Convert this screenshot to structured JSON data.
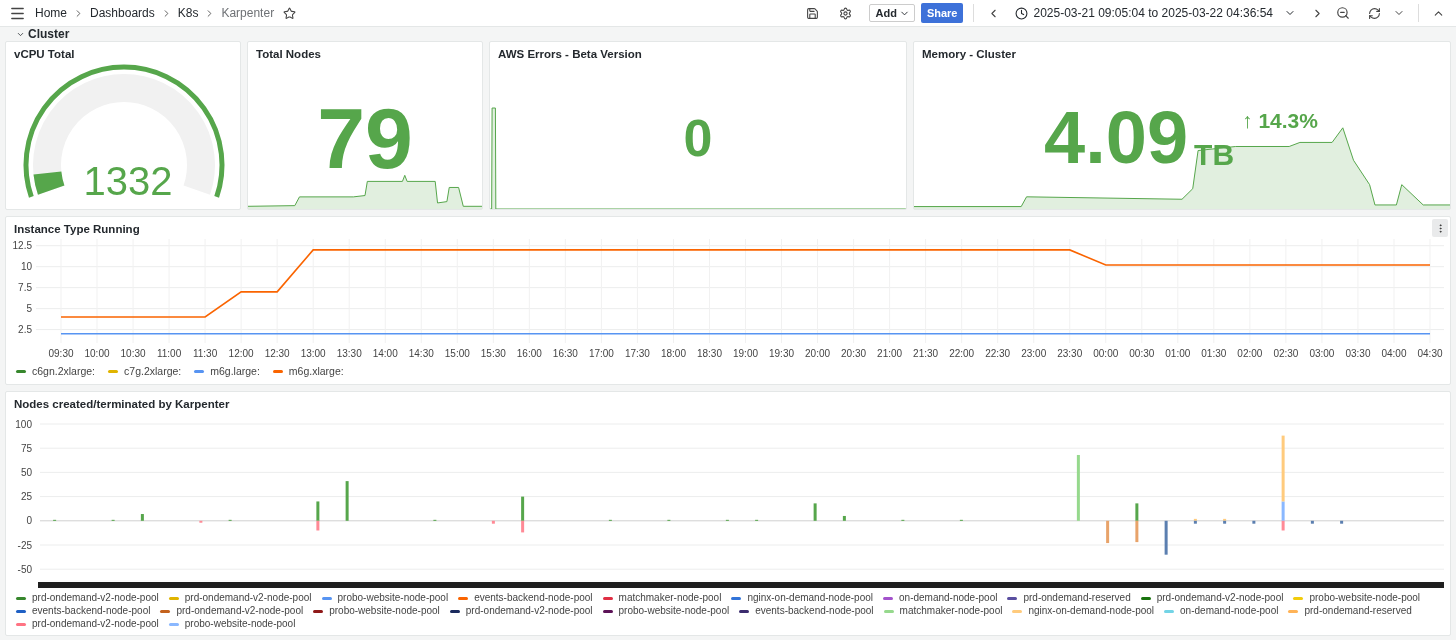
{
  "header": {
    "breadcrumbs": [
      "Home",
      "Dashboards",
      "K8s",
      "Karpenter"
    ],
    "add_button": "Add",
    "share_button": "Share",
    "time_range": "2025-03-21 09:05:04 to 2025-03-22 04:36:54"
  },
  "cluster_row": {
    "title": "Cluster",
    "expanded": true
  },
  "stats": [
    {
      "kind": "gauge",
      "title": "vCPU Total",
      "value": "1332",
      "level": 0.06
    },
    {
      "kind": "stat",
      "title": "Total Nodes",
      "value": "79"
    },
    {
      "kind": "stat",
      "title": "AWS Errors - Beta Version",
      "value": "0"
    },
    {
      "kind": "stat",
      "title": "Memory - Cluster",
      "value": "4.09",
      "unit": "TB",
      "change": "↑ 14.3%"
    }
  ],
  "instance_chart": {
    "title": "Instance Type Running",
    "chart_data": {
      "type": "line",
      "grid": true,
      "x": [
        "09:30",
        "10:00",
        "10:30",
        "11:00",
        "11:30",
        "12:00",
        "12:30",
        "13:00",
        "13:30",
        "14:00",
        "14:30",
        "15:00",
        "15:30",
        "16:00",
        "16:30",
        "17:00",
        "17:30",
        "18:00",
        "18:30",
        "19:00",
        "19:30",
        "20:00",
        "20:30",
        "21:00",
        "21:30",
        "22:00",
        "22:30",
        "23:00",
        "23:30",
        "00:00",
        "00:30",
        "01:00",
        "01:30",
        "02:00",
        "02:30",
        "03:00",
        "03:30",
        "04:00",
        "04:30"
      ],
      "yticks": [
        2.5,
        5,
        7.5,
        10,
        12.5
      ],
      "ylim": [
        0.9,
        13.3
      ],
      "series": [
        {
          "name": "c6gn.2xlarge:",
          "color": "#37872d",
          "values": [
            null,
            null,
            null,
            null,
            null,
            null,
            null,
            null,
            null,
            null,
            null,
            null,
            null,
            null,
            null,
            null,
            null,
            null,
            null,
            null,
            null,
            null,
            null,
            null,
            null,
            null,
            null,
            null,
            null,
            null,
            null,
            null,
            null,
            null,
            null,
            null,
            null,
            null,
            null
          ]
        },
        {
          "name": "c7g.2xlarge:",
          "color": "#e0b400",
          "values": [
            null,
            null,
            null,
            null,
            null,
            null,
            null,
            null,
            null,
            null,
            null,
            null,
            null,
            null,
            null,
            null,
            null,
            null,
            null,
            null,
            null,
            null,
            null,
            null,
            null,
            null,
            null,
            null,
            null,
            null,
            null,
            null,
            null,
            null,
            null,
            null,
            null,
            null,
            null
          ]
        },
        {
          "name": "m6g.large:",
          "color": "#5794f2",
          "values": [
            2,
            2,
            2,
            2,
            2,
            2,
            2,
            2,
            2,
            2,
            2,
            2,
            2,
            2,
            2,
            2,
            2,
            2,
            2,
            2,
            2,
            2,
            2,
            2,
            2,
            2,
            2,
            2,
            2,
            2,
            2,
            2,
            2,
            2,
            2,
            2,
            2,
            2,
            2
          ]
        },
        {
          "name": "m6g.xlarge:",
          "color": "#fa6400",
          "values": [
            4,
            4,
            4,
            4,
            4,
            7,
            7,
            12,
            12,
            12,
            12,
            12,
            12,
            12,
            12,
            12,
            12,
            12,
            12,
            12,
            12,
            12,
            12,
            12,
            12,
            12,
            12,
            12,
            12,
            10.2,
            10.2,
            10.2,
            10.2,
            10.2,
            10.2,
            10.2,
            10.2,
            10.2,
            10.2
          ]
        }
      ]
    }
  },
  "nodes_chart": {
    "title": "Nodes created/terminated by Karpenter",
    "y_axis_labels": [
      "100",
      "75",
      "50",
      "25",
      "0",
      "-25",
      "-50"
    ],
    "legend": [
      {
        "name": "prd-ondemand-v2-node-pool",
        "color": "#37872d"
      },
      {
        "name": "prd-ondemand-v2-node-pool",
        "color": "#e0b400"
      },
      {
        "name": "probo-website-node-pool",
        "color": "#5794f2"
      },
      {
        "name": "events-backend-node-pool",
        "color": "#fa6400"
      },
      {
        "name": "matchmaker-node-pool",
        "color": "#e02f44"
      },
      {
        "name": "nginx-on-demand-node-pool",
        "color": "#3274d9"
      },
      {
        "name": "on-demand-node-pool",
        "color": "#a352cc"
      },
      {
        "name": "prd-ondemand-reserved",
        "color": "#5a4fa0"
      },
      {
        "name": "prd-ondemand-v2-node-pool",
        "color": "#19730e"
      },
      {
        "name": "probo-website-node-pool",
        "color": "#f2cc0c"
      },
      {
        "name": "events-backend-node-pool",
        "color": "#1f60c4"
      },
      {
        "name": "prd-ondemand-v2-node-pool",
        "color": "#c4621d"
      },
      {
        "name": "probo-website-node-pool",
        "color": "#8f1919"
      },
      {
        "name": "prd-ondemand-v2-node-pool",
        "color": "#1b2b5e"
      },
      {
        "name": "probo-website-node-pool",
        "color": "#5c1357"
      },
      {
        "name": "events-backend-node-pool",
        "color": "#3b2c6e"
      },
      {
        "name": "matchmaker-node-pool",
        "color": "#96d98d"
      },
      {
        "name": "nginx-on-demand-node-pool",
        "color": "#ffcb7d"
      },
      {
        "name": "on-demand-node-pool",
        "color": "#73d4e6"
      },
      {
        "name": "prd-ondemand-reserved",
        "color": "#ffb357"
      },
      {
        "name": "prd-ondemand-v2-node-pool",
        "color": "#ff7383"
      },
      {
        "name": "probo-website-node-pool",
        "color": "#8ab8ff"
      }
    ]
  }
}
